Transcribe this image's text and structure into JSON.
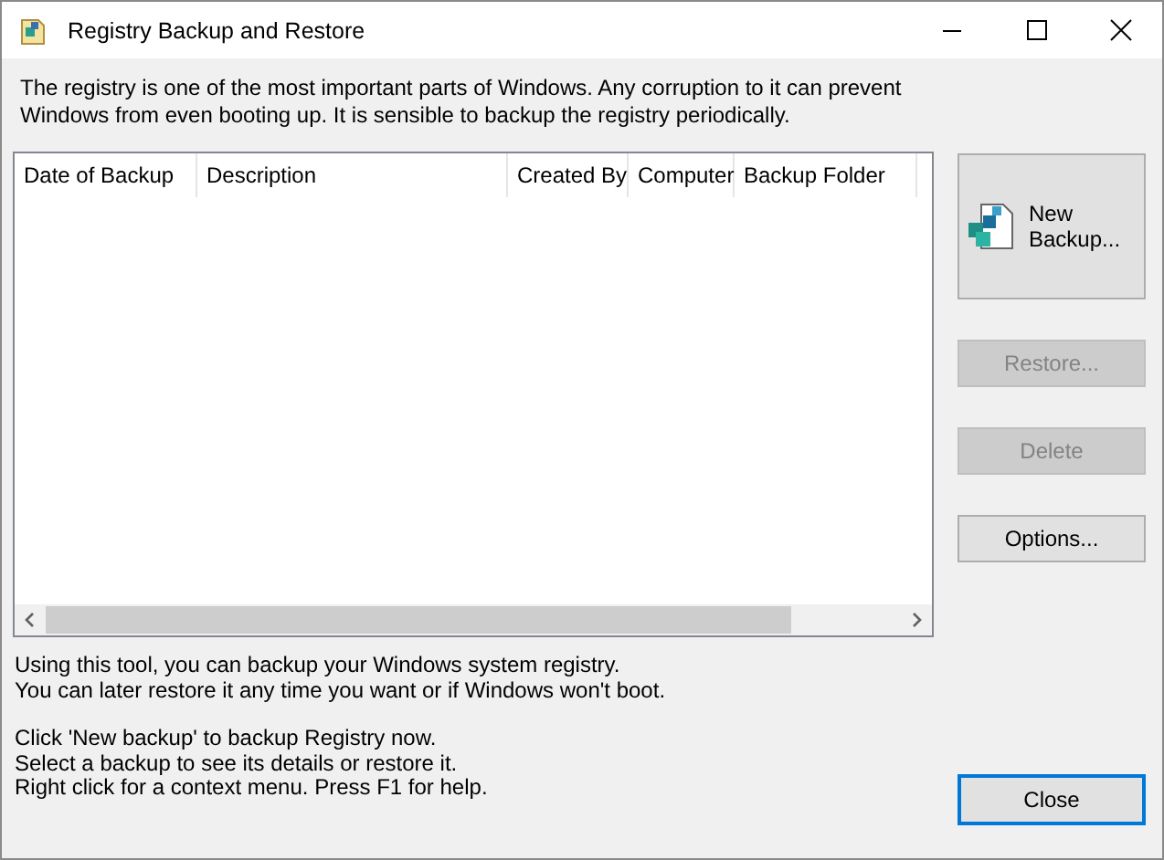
{
  "window": {
    "title": "Registry Backup and Restore"
  },
  "intro": "The registry is one of the most important parts of Windows. Any corruption to it can prevent Windows from even booting up.  It is sensible to backup the registry periodically.",
  "table": {
    "columns": [
      "Date of Backup",
      "Description",
      "Created By",
      "Computer",
      "Backup Folder"
    ]
  },
  "buttons": [
    {
      "kind": "new",
      "label": "New Backup...",
      "disabled": false
    },
    {
      "kind": "plain",
      "label": "Restore...",
      "disabled": true
    },
    {
      "kind": "plain",
      "label": "Delete",
      "disabled": true
    },
    {
      "kind": "plain",
      "label": "Options...",
      "disabled": false
    }
  ],
  "help": [
    [
      "Using this tool, you can backup your Windows system registry.",
      "You can later restore it any time you want or if Windows won't boot."
    ],
    [
      "Click 'New backup' to backup Registry now.",
      "Select a backup to see its details or restore it.",
      "Right click for a context menu. Press F1 for help."
    ]
  ],
  "close_button": {
    "label": "Close",
    "default": true
  }
}
